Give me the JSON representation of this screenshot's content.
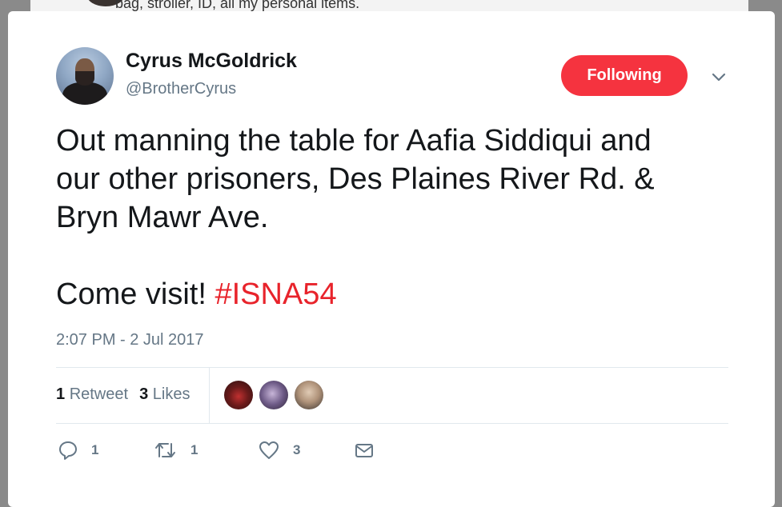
{
  "background_tweet": {
    "snippet": "bag, stroller, ID, all my personal items."
  },
  "tweet": {
    "author": {
      "name": "Cyrus McGoldrick",
      "handle": "@BrotherCyrus"
    },
    "follow_button_label": "Following",
    "text_lines": [
      "Out manning the table for Aafia Siddiqui and",
      "our other prisoners, Des Plaines River Rd. &",
      "Bryn Mawr Ave."
    ],
    "text_last_line_prefix": "Come visit! ",
    "hashtag": "#ISNA54",
    "timestamp": "2:07 PM - 2 Jul 2017",
    "stats": {
      "retweets_count": "1",
      "retweets_label": "Retweet",
      "likes_count": "3",
      "likes_label": "Likes"
    },
    "actions": {
      "reply_count": "1",
      "retweet_count": "1",
      "like_count": "3"
    }
  },
  "colors": {
    "follow_button_bg": "#f5333f",
    "hashtag": "#e8232b",
    "secondary_text": "#657786",
    "primary_text": "#14171a"
  },
  "icons": [
    "chevron-down-icon",
    "reply-icon",
    "retweet-icon",
    "heart-icon",
    "envelope-icon"
  ]
}
